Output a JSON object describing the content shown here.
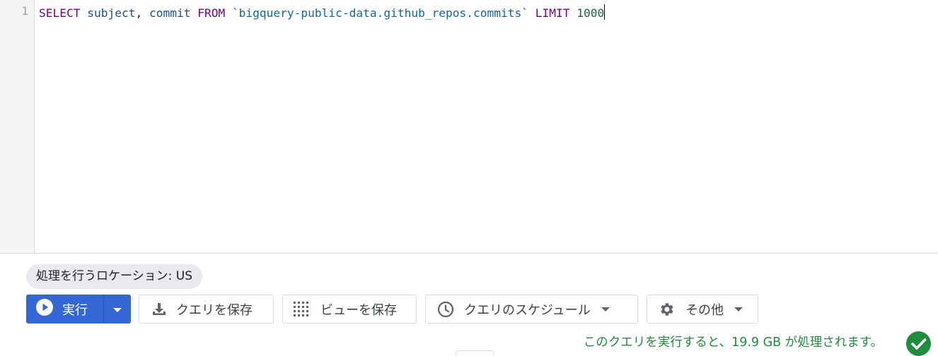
{
  "editor": {
    "line_number": "1",
    "tokens": {
      "select": "SELECT",
      "col1": "subject",
      "comma": ",",
      "col2": "commit",
      "from": "FROM",
      "table": "`bigquery-public-data.github_repos.commits`",
      "limit": "LIMIT",
      "limit_value": "1000"
    }
  },
  "location_chip": "処理を行うロケーション: US",
  "toolbar": {
    "run_label": "実行",
    "save_query_label": "クエリを保存",
    "save_view_label": "ビューを保存",
    "schedule_label": "クエリのスケジュール",
    "more_label": "その他"
  },
  "status": {
    "message": "このクエリを実行すると、19.9 GB が処理されます。"
  },
  "icons": {
    "run": "play-circle-icon",
    "run_dropdown": "caret-down-icon",
    "save_query": "download-icon",
    "save_view": "grid-dots-icon",
    "schedule": "clock-icon",
    "more": "gear-icon",
    "status": "check-circle-icon"
  },
  "colors": {
    "primary": "#3367d6",
    "success": "#1e8e3e",
    "keyword": "#770088"
  }
}
